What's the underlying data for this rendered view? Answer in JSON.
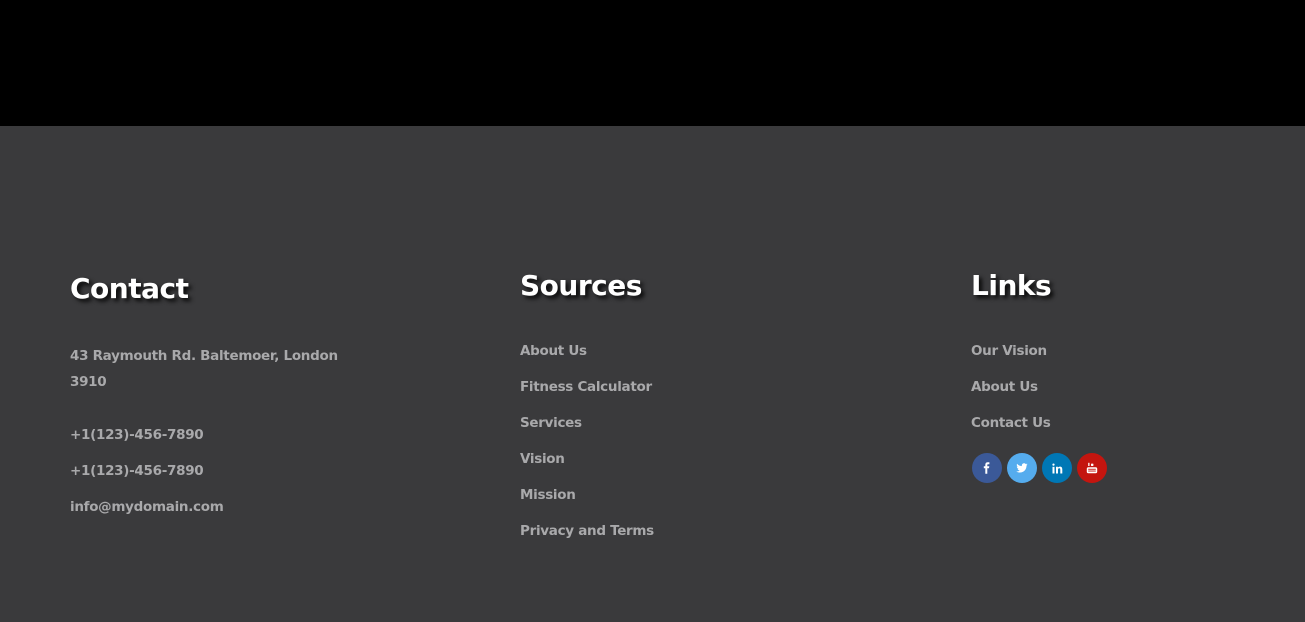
{
  "contact": {
    "heading": "Contact",
    "address": "43 Raymouth Rd. Baltemoer, London 3910",
    "phone_1": "+1(123)-456-7890",
    "phone_2": "+1(123)-456-7890",
    "email": "info@mydomain.com"
  },
  "sources": {
    "heading": "Sources",
    "items": [
      {
        "label": "About Us"
      },
      {
        "label": "Fitness Calculator"
      },
      {
        "label": "Services"
      },
      {
        "label": "Vision"
      },
      {
        "label": "Mission"
      },
      {
        "label": "Privacy and Terms"
      }
    ]
  },
  "links": {
    "heading": "Links",
    "items": [
      {
        "label": "Our Vision"
      },
      {
        "label": "About Us"
      },
      {
        "label": "Contact Us"
      }
    ],
    "social": [
      {
        "icon": "facebook-icon",
        "color": "#3b5998"
      },
      {
        "icon": "twitter-icon",
        "color": "#55acee"
      },
      {
        "icon": "linkedin-icon",
        "color": "#0077b5"
      },
      {
        "icon": "youtube-icon",
        "color": "#c4150f"
      }
    ]
  },
  "colors": {
    "top_band": "#000000",
    "footer_background": "#3a3a3c",
    "heading_text": "#ffffff",
    "body_text": "#a9a9ab"
  }
}
